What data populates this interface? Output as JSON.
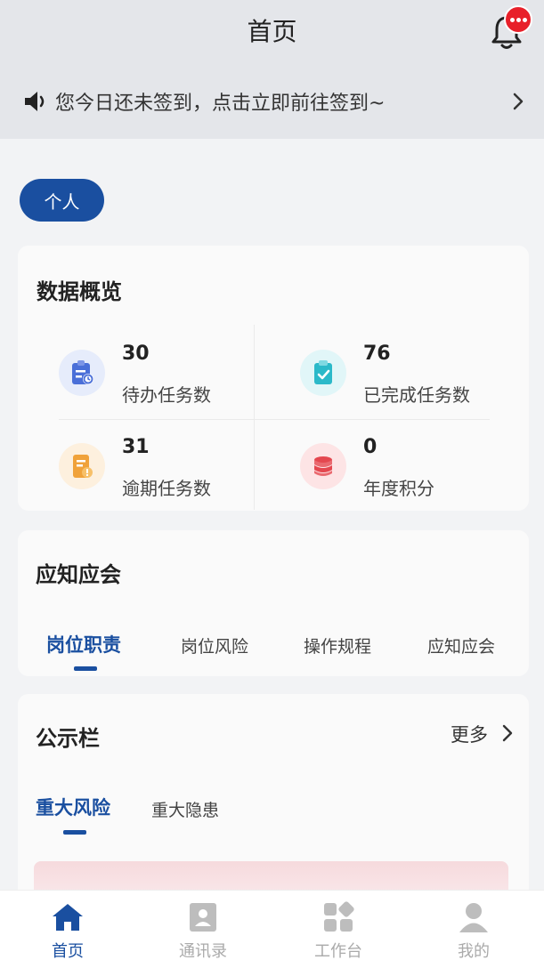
{
  "header": {
    "title": "首页",
    "bell_icon": "bell-icon",
    "badge_icon": "ellipsis-icon"
  },
  "notice": {
    "icon": "speaker-icon",
    "text": "您今日还未签到，点击立即前往签到~",
    "arrow_icon": "chevron-right-icon"
  },
  "scope_tab": {
    "label": "个人"
  },
  "overview": {
    "title": "数据概览",
    "stats": [
      {
        "value": "30",
        "label": "待办任务数",
        "icon": "todo-clipboard-icon",
        "color": "#4a6fd8"
      },
      {
        "value": "76",
        "label": "已完成任务数",
        "icon": "completed-clipboard-icon",
        "color": "#2bb9c9"
      },
      {
        "value": "31",
        "label": "逾期任务数",
        "icon": "overdue-document-icon",
        "color": "#f0a23a"
      },
      {
        "value": "0",
        "label": "年度积分",
        "icon": "coins-stack-icon",
        "color": "#e4474f"
      }
    ]
  },
  "knowledge": {
    "title": "应知应会",
    "tabs": [
      {
        "label": "岗位职责",
        "active": true
      },
      {
        "label": "岗位风险",
        "active": false
      },
      {
        "label": "操作规程",
        "active": false
      },
      {
        "label": "应知应会",
        "active": false
      }
    ]
  },
  "board": {
    "title": "公示栏",
    "more_label": "更多",
    "tabs": [
      {
        "label": "重大风险",
        "active": true
      },
      {
        "label": "重大隐患",
        "active": false
      }
    ]
  },
  "tabbar": {
    "items": [
      {
        "label": "首页",
        "icon": "home-icon",
        "active": true
      },
      {
        "label": "通讯录",
        "icon": "contacts-icon",
        "active": false
      },
      {
        "label": "工作台",
        "icon": "workbench-icon",
        "active": false
      },
      {
        "label": "我的",
        "icon": "profile-icon",
        "active": false
      }
    ]
  },
  "colors": {
    "brand": "#1a4fa0",
    "badge": "#e8202a"
  }
}
